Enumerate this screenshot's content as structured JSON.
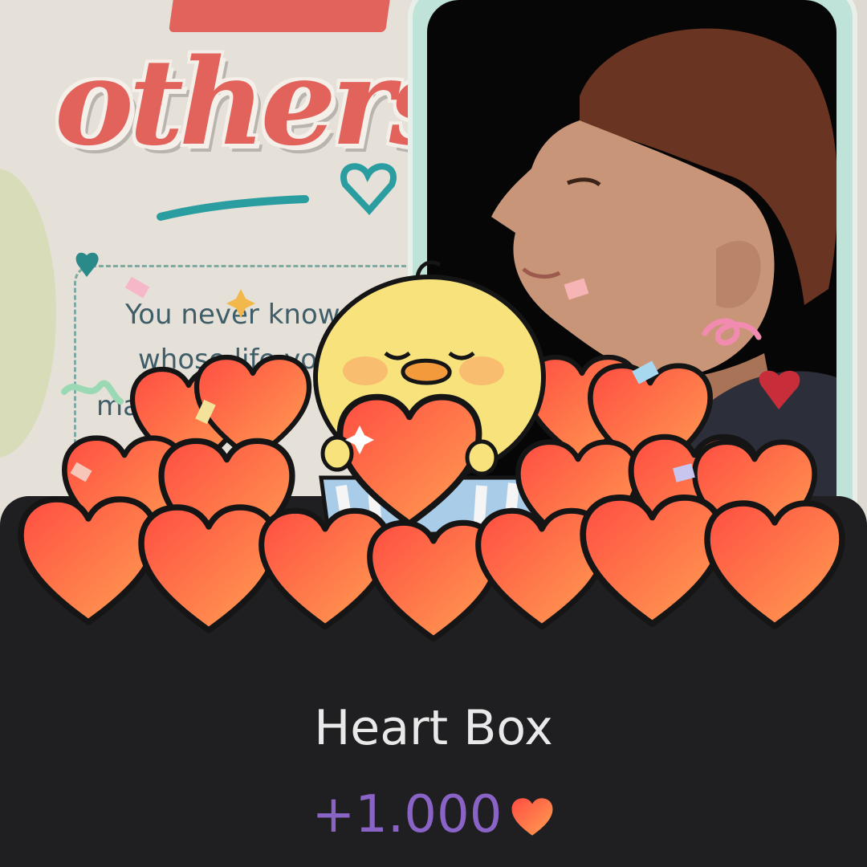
{
  "poster": {
    "headline": "others",
    "quote_lines": [
      "You never know",
      "whose life you",
      "ma"
    ]
  },
  "reward": {
    "title": "Heart Box",
    "amount": "+1.000",
    "amount_icon": "heart-icon"
  },
  "colors": {
    "panel": "#1f1f21",
    "amount": "#8a63c6",
    "heart": "#f2663f",
    "chick": "#f7e27c"
  }
}
